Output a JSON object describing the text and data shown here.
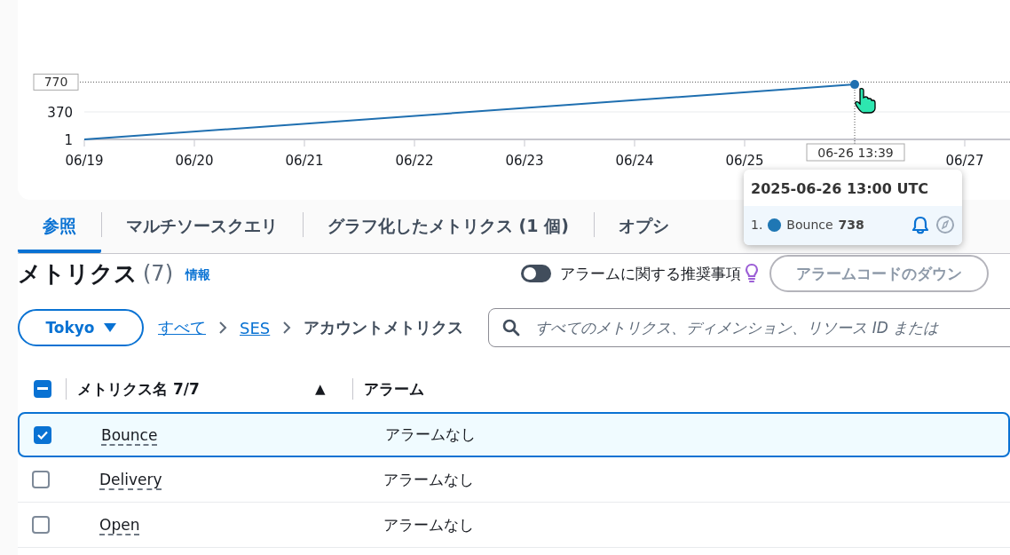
{
  "chart": {
    "chart_data": {
      "type": "line",
      "categories": [
        "06/19",
        "06/20",
        "06/21",
        "06/22",
        "06/23",
        "06/24",
        "06/25",
        null,
        "06/27"
      ],
      "series": [
        {
          "color": "#1f6fb0",
          "values": [
            1,
            null,
            null,
            null,
            null,
            null,
            null,
            738,
            null
          ]
        }
      ],
      "yticks": [
        1,
        370
      ],
      "ylim": [
        1,
        1870
      ],
      "ref_lines": [
        {
          "axis": "y",
          "value": 770,
          "label": "770"
        }
      ]
    },
    "hover_time": "06-26 13:39"
  },
  "tooltip": {
    "title": "2025-06-26 13:00 UTC",
    "items": [
      {
        "index": "1.",
        "name": "Bounce",
        "value": "738",
        "color": "#1f77b4"
      }
    ]
  },
  "tabs": [
    {
      "label": "参照",
      "selected": true
    },
    {
      "label": "マルチソースクエリ",
      "selected": false
    },
    {
      "label": "グラフ化したメトリクス (1 個)",
      "selected": false
    },
    {
      "label": "オプシ",
      "selected": false
    }
  ],
  "metrics": {
    "title": "メトリクス",
    "count": "(7)",
    "info": "情報"
  },
  "alarm_toggle": {
    "label": "アラームに関する推奨事項",
    "on": false
  },
  "download_button": "アラームコードのダウン",
  "region": "Tokyo",
  "breadcrumb": [
    {
      "label": "すべて",
      "link": true
    },
    {
      "label": "SES",
      "link": true
    },
    {
      "label": "アカウントメトリクス",
      "link": false
    }
  ],
  "search": {
    "placeholder": "すべてのメトリクス、ディメンション、リソース ID または"
  },
  "table": {
    "indeterminate": true,
    "columns": [
      {
        "label": "メトリクス名 7/7",
        "sort": "▲"
      },
      {
        "label": "アラーム"
      }
    ],
    "rows": [
      {
        "name": "Bounce",
        "alarm": "アラームなし",
        "selected": true
      },
      {
        "name": "Delivery",
        "alarm": "アラームなし",
        "selected": false
      },
      {
        "name": "Open",
        "alarm": "アラームなし",
        "selected": false
      }
    ]
  }
}
